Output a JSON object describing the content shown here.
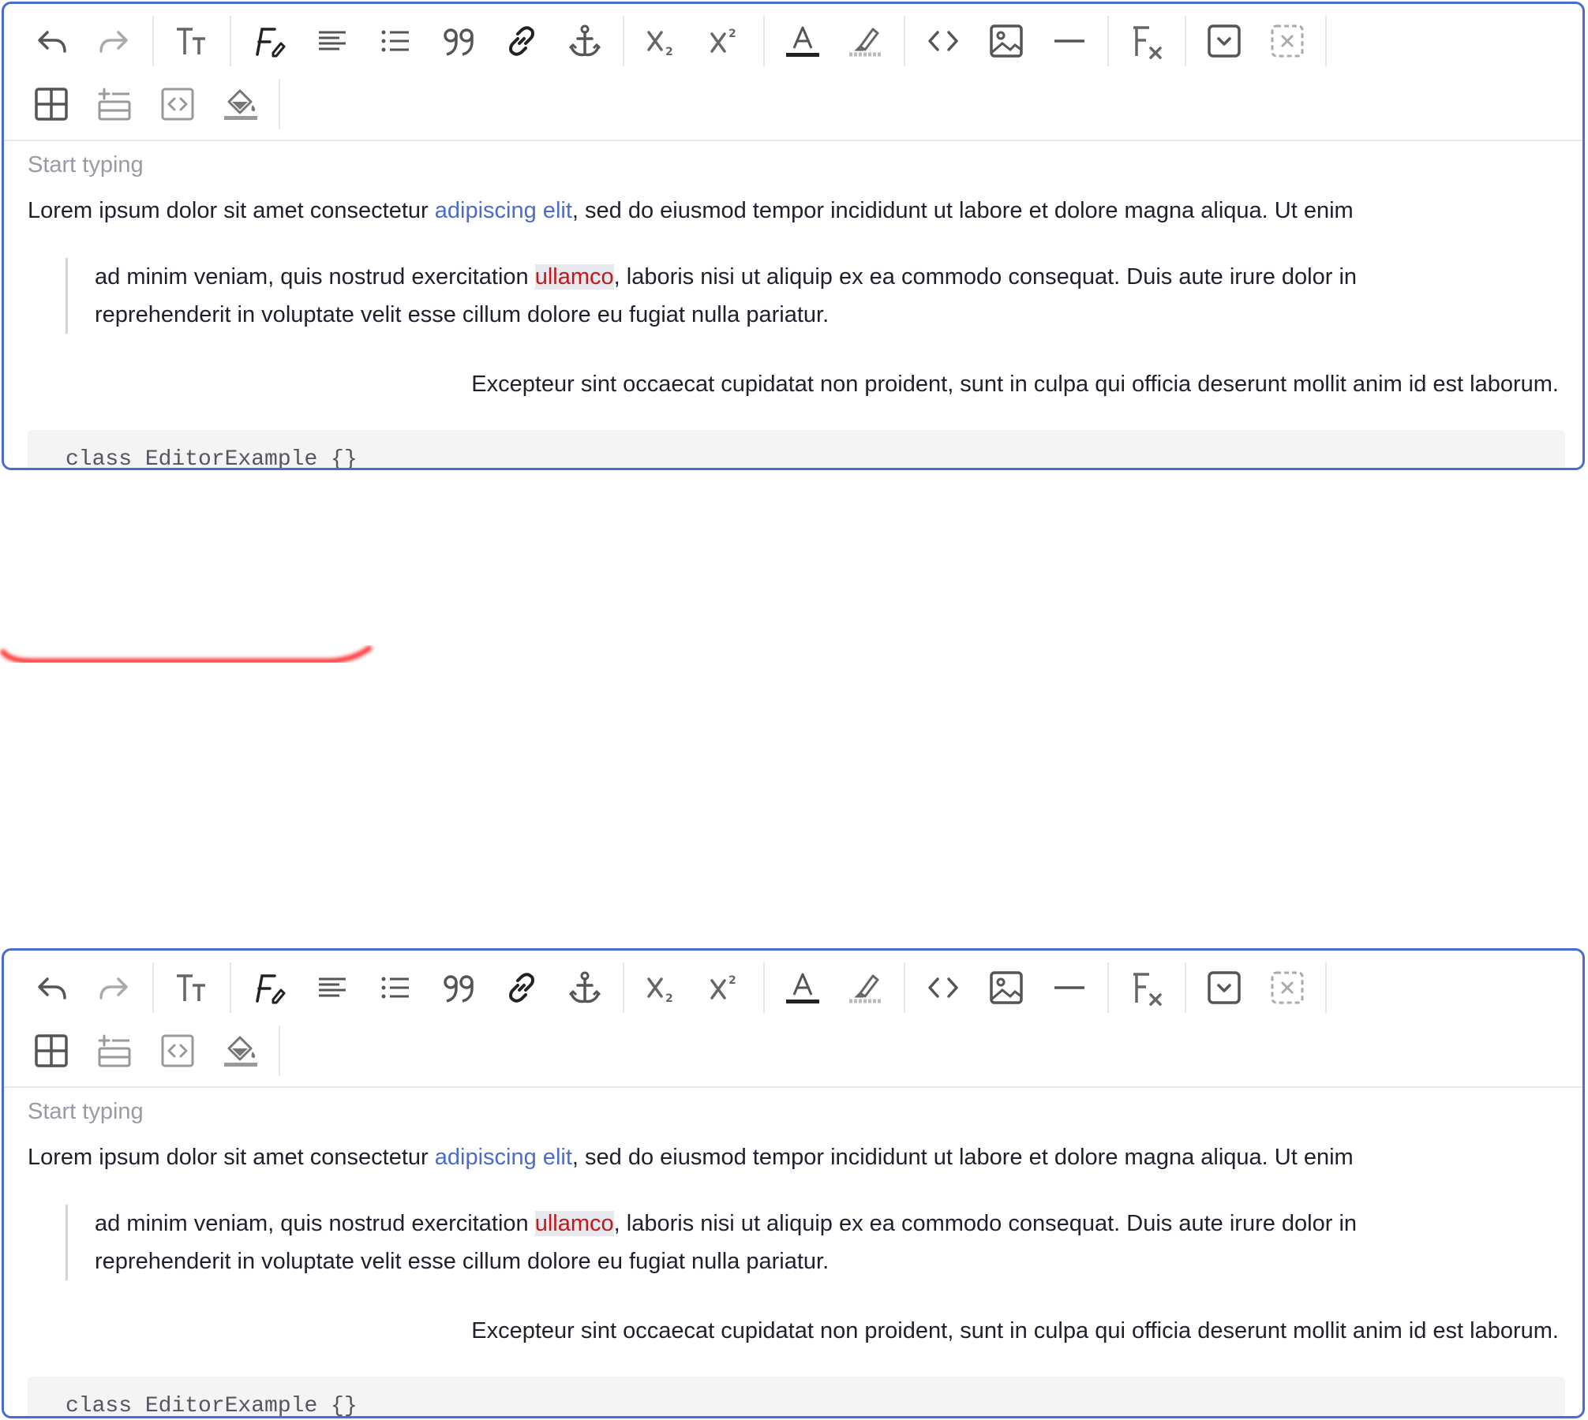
{
  "editors": [
    {
      "placeholder": "Start typing",
      "paragraph1": {
        "before": "Lorem ipsum dolor sit amet consectetur ",
        "link": "adipiscing elit",
        "after": ", sed do eiusmod tempor incididunt ut labore et dolore magna aliqua. Ut enim"
      },
      "quote": {
        "before": "ad minim veniam, quis nostrud exercitation ",
        "highlight": "ullamco",
        "after": ", laboris nisi ut aliquip ex ea commodo consequat. Duis aute irure dolor in",
        "line2": "reprehenderit in voluptate velit esse cillum dolore eu fugiat nulla pariatur."
      },
      "right_paragraph": "Excepteur sint occaecat cupidatat non proident, sunt in culpa qui officia deserunt mollit anim id est laborum.",
      "code": "class EditorExample {}"
    },
    {
      "placeholder": "Start typing",
      "paragraph1": {
        "before": "Lorem ipsum dolor sit amet consectetur ",
        "link": "adipiscing elit",
        "after": ", sed do eiusmod tempor incididunt ut labore et dolore magna aliqua. Ut enim"
      },
      "quote": {
        "before": "ad minim veniam, quis nostrud exercitation ",
        "highlight": "ullamco",
        "after": ", laboris nisi ut aliquip ex ea commodo consequat. Duis aute irure dolor in",
        "line2": "reprehenderit in voluptate velit esse cillum dolore eu fugiat nulla pariatur."
      },
      "right_paragraph": "Excepteur sint occaecat cupidatat non proident, sunt in culpa qui officia deserunt mollit anim id est laborum.",
      "code": "class EditorExample {}"
    }
  ],
  "toolbar": {
    "row1": [
      "undo-icon",
      "redo-icon",
      "|",
      "text-size-icon",
      "|",
      "font-style-icon",
      "align-icon",
      "list-icon",
      "blockquote-icon",
      "link-icon",
      "anchor-icon",
      "|",
      "subscript-icon",
      "superscript-icon",
      "|",
      "text-color-icon",
      "highlight-icon",
      "|",
      "code-icon",
      "image-icon",
      "horizontal-rule-icon",
      "|",
      "clear-format-icon",
      "|",
      "dropdown-box-icon",
      "remove-box-icon",
      "|"
    ],
    "row2": [
      "table-icon",
      "insert-row-icon",
      "embed-code-icon",
      "fill-color-icon",
      "|"
    ]
  },
  "colors": {
    "border": "#4a6bd0",
    "link": "#4a6bd0",
    "highlight_text": "#c41818",
    "glitch": "#ff3b3b"
  }
}
